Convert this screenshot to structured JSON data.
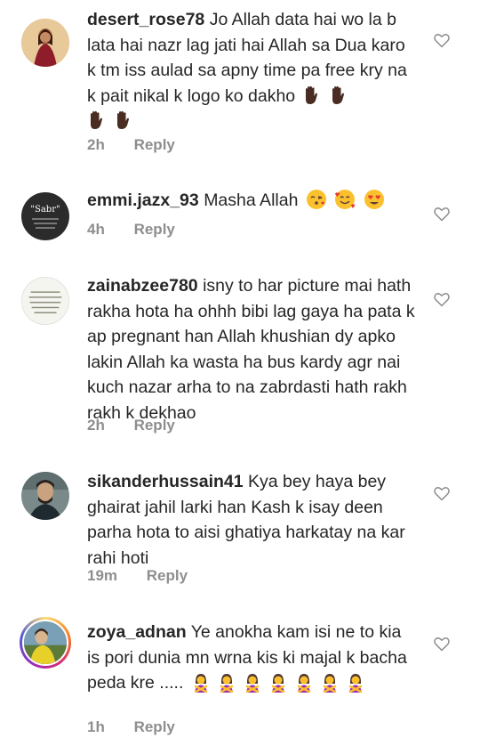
{
  "comments": [
    {
      "username": "desert_rose78",
      "text": "Jo Allah data hai wo la b lata hai nazr lag jati hai Allah sa Dua karo k tm iss aulad sa apny time pa free kry na k pait nikal k logo ko dakho",
      "emoji": [
        "raised-hand",
        "raised-hand",
        "raised-hand",
        "raised-hand"
      ],
      "time": "2h",
      "reply": "Reply"
    },
    {
      "username": "emmi.jazx_93",
      "text": "Masha Allah",
      "emoji": [
        "face-blowing-kiss",
        "smiling-face-with-hearts",
        "heart-eyes-face"
      ],
      "time": "4h",
      "reply": "Reply",
      "avatar_text": "\"Sabr\""
    },
    {
      "username": "zainabzee780",
      "text": "isny to har picture mai hath rakha hota ha ohhh bibi lag gaya ha pata k ap pregnant han Allah khushian dy apko lakin Allah ka wasta ha bus kardy agr nai kuch nazar arha to na zabrdasti hath rakh rakh k dekhao",
      "time": "2h",
      "reply": "Reply"
    },
    {
      "username": "sikanderhussain41",
      "text": "Kya bey haya bey ghairat jahil larki han Kash k isay deen parha hota to aisi ghatiya harkatay na kar rahi hoti",
      "time": "19m",
      "reply": "Reply"
    },
    {
      "username": "zoya_adnan",
      "text": "Ye anokha kam isi ne to kia is pori dunia mn wrna kis ki majal k bacha peda kre .....",
      "emoji": [
        "woman-gesturing-no",
        "woman-gesturing-no",
        "woman-gesturing-no",
        "woman-gesturing-no",
        "woman-gesturing-no",
        "woman-gesturing-no",
        "woman-gesturing-no"
      ],
      "time": "1h",
      "reply": "Reply"
    }
  ],
  "icons": {
    "like": "heart-outline-icon"
  },
  "colors": {
    "text": "#262626",
    "meta": "#8e8e8e",
    "background": "#ffffff"
  }
}
